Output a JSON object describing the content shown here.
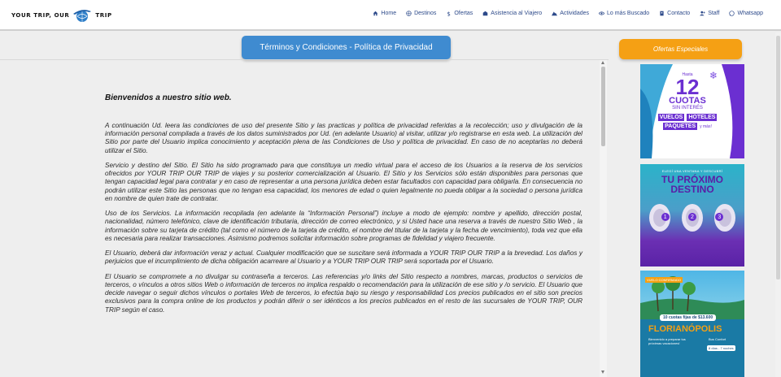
{
  "brand": {
    "left": "YOUR TRIP, OUR",
    "right": "TRIP"
  },
  "nav": {
    "items": [
      {
        "label": "Home",
        "icon": "home-icon"
      },
      {
        "label": "Destinos",
        "icon": "globe-icon"
      },
      {
        "label": "Ofertas",
        "icon": "dollar-icon"
      },
      {
        "label": "Asistencia al Viajero",
        "icon": "building-icon"
      },
      {
        "label": "Actividades",
        "icon": "mountain-icon"
      },
      {
        "label": "Lo más Buscado",
        "icon": "eye-icon"
      },
      {
        "label": "Contacto",
        "icon": "address-book-icon"
      },
      {
        "label": "Staff",
        "icon": "user-plus-icon"
      },
      {
        "label": "Whatsapp",
        "icon": "whatsapp-icon"
      }
    ]
  },
  "page": {
    "title": "Términos y Condiciones - Política de Privacidad",
    "welcome": "Bienvenidos a nuestro sitio web.",
    "paragraphs": [
      "A continuación Ud. leera las condiciones de uso del presente Sitio y las practicas y política de privacidad referidas a la recolección; uso y divulgación de la información personal compilada a través de los datos suministrados por Ud. (en adelante Usuario) al visitar, utilizar y/o registrarse en esta web. La utilización del Sitio por parte del Usuario implica conocimiento y aceptación plena de las Condiciones de Uso y política de privacidad. En caso de no aceptarlas no deberá utilizar el Sitio.",
      "Servicio y destino del Sitio. El Sitio ha sido programado para que constituya un medio virtual para el acceso de los Usuarios a la reserva de los servicios ofrecidos por YOUR TRIP OUR TRIP de viajes y su posterior comercialización al Usuario. El Sitio y los Servicios sólo están disponibles para personas que tengan capacidad legal para contratar y en caso de representar a una persona jurídica deben estar facultados con capacidad para obligarla. En consecuencia no podrán utilizar este Sitio las personas que no tengan esa capacidad, los menores de edad o quien legalmente no pueda obligar a la sociedad o persona jurídica en nombre de quien trate de contratar.",
      "Uso de los Servicios. La información recopilada (en adelante la “Información Personal”) incluye a modo de ejemplo: nombre y apellido, dirección postal, nacionalidad, número telefónico, clave de identificación tributaria, dirección de correo electrónico, y si Usted hace una reserva a través de nuestro Sitio Web , la información sobre su tarjeta de crédito (tal como el número de la tarjeta de crédito, el nombre del titular de la tarjeta y la fecha de vencimiento), toda vez que ella es necesaria para realizar transacciones. Asimismo podremos solicitar información sobre programas de fidelidad y viajero frecuente.",
      "El Usuario, deberá dar información veraz y actual. Cualquier modificación que se suscitare será informada a YOUR TRIP OUR TRIP a la brevedad. Los daños y perjuicios que el incumplimiento de dicha obligación acarreare al Usuario y a YOUR TRIP OUR TRIP será soportada por el Usuario.",
      "El Usuario se compromete a no divulgar su contraseña a terceros. Las referencias y/o links del Sitio respecto a nombres, marcas, productos o servicios de terceros, o vínculos a otros sitios Web o información de terceros no implica respaldo o recomendación para la utilización de ese sitio y /o servicio. El Usuario que decide navegar o seguir dichos vínculos o portales Web de terceros, lo efectúa bajo su riesgo y responsabilidad Los precios publicados en el sitio son precios exclusivos para la compra online de los productos y podrán diferir o ser idénticos a los precios publicados en el resto de las sucursales de YOUR TRIP, OUR TRIP según el caso."
    ]
  },
  "sidebar": {
    "title": "Ofertas Especiales",
    "banners": [
      {
        "top": "Hasta",
        "number": "12",
        "line1": "CUOTAS",
        "line2": "SIN INTERÉS",
        "tag1": "VUELOS",
        "tag2": "HOTELES",
        "tag3": "PAQUETES",
        "extra": "y más!"
      },
      {
        "top": "ELEGÍ UNA VENTANA Y DESCUBRÍ",
        "line1": "TU PRÓXIMO",
        "line2": "DESTINO",
        "windows": [
          "1",
          "2",
          "3"
        ]
      },
      {
        "badge": "VUELO CONFIRMADO",
        "price": "10 cuotas fijas de $13.600",
        "city": "FLORIANÓPOLIS",
        "sub": "Bienvenido a preparar tus próximas vacaciones!",
        "detail1": "Bus Confort",
        "detail2": "8 días - 7 noches"
      }
    ]
  },
  "colors": {
    "nav_text": "#2d4a8a",
    "title_tab": "#3f8bd0",
    "offers_tab": "#f5a014",
    "banner_purple": "#6b2fd1"
  }
}
